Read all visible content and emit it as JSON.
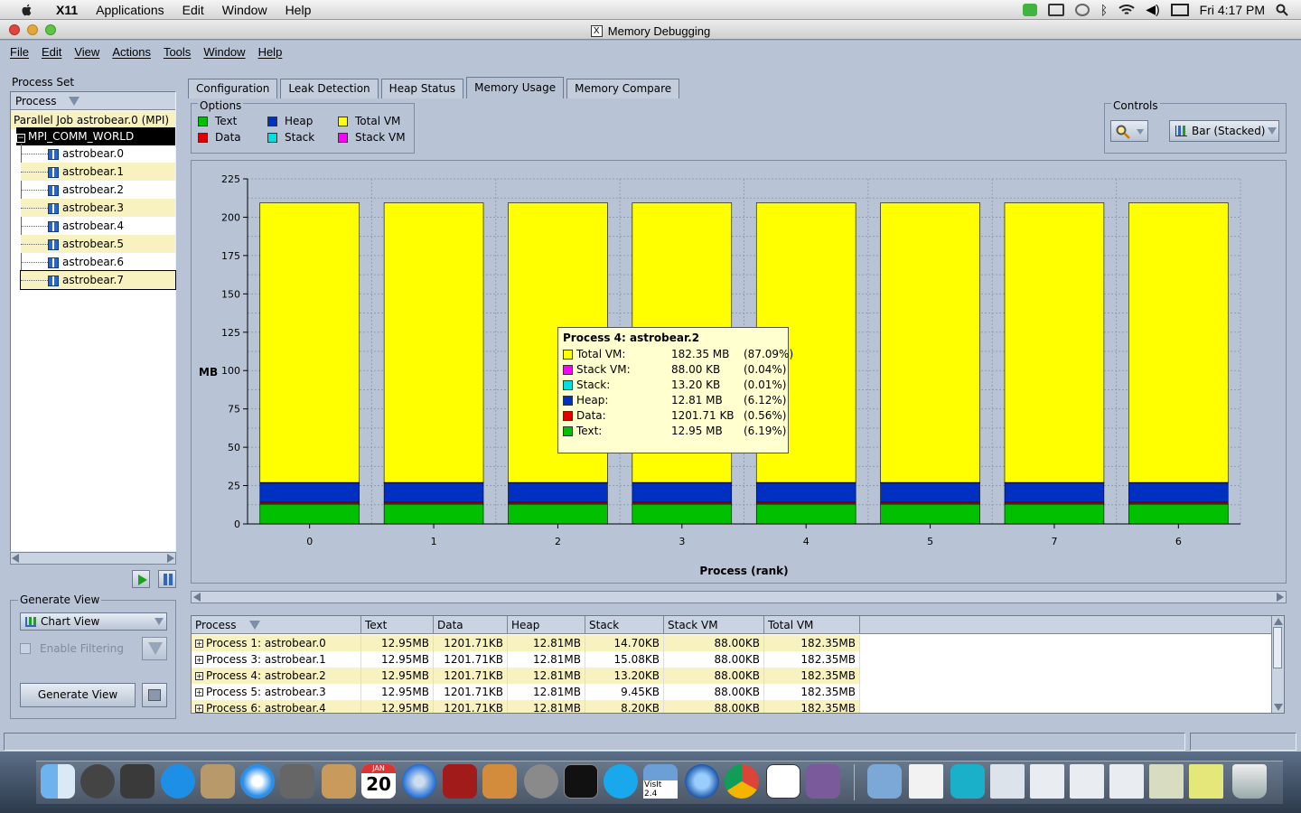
{
  "menubar": {
    "app": "X11",
    "items": [
      "Applications",
      "Edit",
      "Window",
      "Help"
    ],
    "clock": "Fri 4:17 PM"
  },
  "window": {
    "title": "Memory Debugging"
  },
  "appmenu": {
    "items": [
      "File",
      "Edit",
      "View",
      "Actions",
      "Tools",
      "Window",
      "Help"
    ]
  },
  "left": {
    "process_set_label": "Process Set",
    "tree_header": "Process",
    "job": "Parallel Job astrobear.0 (MPI)",
    "comm": "MPI_COMM_WORLD",
    "processes": [
      "astrobear.0",
      "astrobear.1",
      "astrobear.2",
      "astrobear.3",
      "astrobear.4",
      "astrobear.5",
      "astrobear.6",
      "astrobear.7"
    ],
    "generate_view_label": "Generate View",
    "view_select": "Chart View",
    "enable_filtering": "Enable Filtering",
    "generate_button": "Generate View"
  },
  "tabs": [
    "Configuration",
    "Leak Detection",
    "Heap Status",
    "Memory Usage",
    "Memory Compare"
  ],
  "active_tab": "Memory Usage",
  "options": {
    "title": "Options",
    "items": [
      {
        "label": "Text",
        "color": "#00c000"
      },
      {
        "label": "Data",
        "color": "#e00000"
      },
      {
        "label": "Heap",
        "color": "#0030c0"
      },
      {
        "label": "Stack",
        "color": "#00e0e0"
      },
      {
        "label": "Total VM",
        "color": "#ffff00"
      },
      {
        "label": "Stack VM",
        "color": "#ff00ff"
      }
    ]
  },
  "controls": {
    "title": "Controls",
    "chart_type": "Bar (Stacked)"
  },
  "chart_data": {
    "type": "bar",
    "stacked": true,
    "categories": [
      "0",
      "1",
      "2",
      "3",
      "4",
      "5",
      "7",
      "6"
    ],
    "series": [
      {
        "name": "Text",
        "color": "#00c000",
        "values": [
          12.95,
          12.95,
          12.95,
          12.95,
          12.95,
          12.95,
          12.95,
          12.95
        ]
      },
      {
        "name": "Data",
        "color": "#e00000",
        "values": [
          1.17,
          1.17,
          1.17,
          1.17,
          1.17,
          1.17,
          1.17,
          1.17
        ]
      },
      {
        "name": "Heap",
        "color": "#0030c0",
        "values": [
          12.81,
          12.81,
          12.81,
          12.81,
          12.81,
          12.81,
          12.81,
          12.81
        ]
      },
      {
        "name": "Stack",
        "color": "#00e0e0",
        "values": [
          0.01,
          0.01,
          0.01,
          0.01,
          0.01,
          0.01,
          0.01,
          0.01
        ]
      },
      {
        "name": "Stack VM",
        "color": "#ff00ff",
        "values": [
          0.09,
          0.09,
          0.09,
          0.09,
          0.09,
          0.09,
          0.09,
          0.09
        ]
      },
      {
        "name": "Total VM",
        "color": "#ffff00",
        "values": [
          182.35,
          182.35,
          182.35,
          182.35,
          182.35,
          182.35,
          182.35,
          182.35
        ]
      }
    ],
    "ylabel": "MB",
    "xlabel": "Process (rank)",
    "ylim": [
      0,
      225
    ],
    "yticks": [
      0,
      25,
      50,
      75,
      100,
      125,
      150,
      175,
      200,
      225
    ],
    "grid": true
  },
  "tooltip": {
    "title": "Process 4: astrobear.2",
    "rows": [
      {
        "label": "Total VM:",
        "value": "182.35 MB",
        "pct": "(87.09%)",
        "color": "#ffff00"
      },
      {
        "label": "Stack VM:",
        "value": "88.00 KB",
        "pct": "(0.04%)",
        "color": "#ff00ff"
      },
      {
        "label": "Stack:",
        "value": "13.20 KB",
        "pct": "(0.01%)",
        "color": "#00e0e0"
      },
      {
        "label": "Heap:",
        "value": "12.81 MB",
        "pct": "(6.12%)",
        "color": "#0030c0"
      },
      {
        "label": "Data:",
        "value": "1201.71 KB",
        "pct": "(0.56%)",
        "color": "#e00000"
      },
      {
        "label": "Text:",
        "value": "12.95 MB",
        "pct": "(6.19%)",
        "color": "#00c000"
      }
    ]
  },
  "table": {
    "columns": [
      "Process",
      "Text",
      "Data",
      "Heap",
      "Stack",
      "Stack VM",
      "Total VM"
    ],
    "rows": [
      [
        "Process 1: astrobear.0",
        "12.95MB",
        "1201.71KB",
        "12.81MB",
        "14.70KB",
        "88.00KB",
        "182.35MB"
      ],
      [
        "Process 3: astrobear.1",
        "12.95MB",
        "1201.71KB",
        "12.81MB",
        "15.08KB",
        "88.00KB",
        "182.35MB"
      ],
      [
        "Process 4: astrobear.2",
        "12.95MB",
        "1201.71KB",
        "12.81MB",
        "13.20KB",
        "88.00KB",
        "182.35MB"
      ],
      [
        "Process 5: astrobear.3",
        "12.95MB",
        "1201.71KB",
        "12.81MB",
        "9.45KB",
        "88.00KB",
        "182.35MB"
      ],
      [
        "Process 6: astrobear.4",
        "12.95MB",
        "1201.71KB",
        "12.81MB",
        "8.20KB",
        "88.00KB",
        "182.35MB"
      ]
    ]
  },
  "dock": {
    "calendar_day": "20",
    "calendar_month": "JAN",
    "visit_label": "VisIt 2.4"
  }
}
